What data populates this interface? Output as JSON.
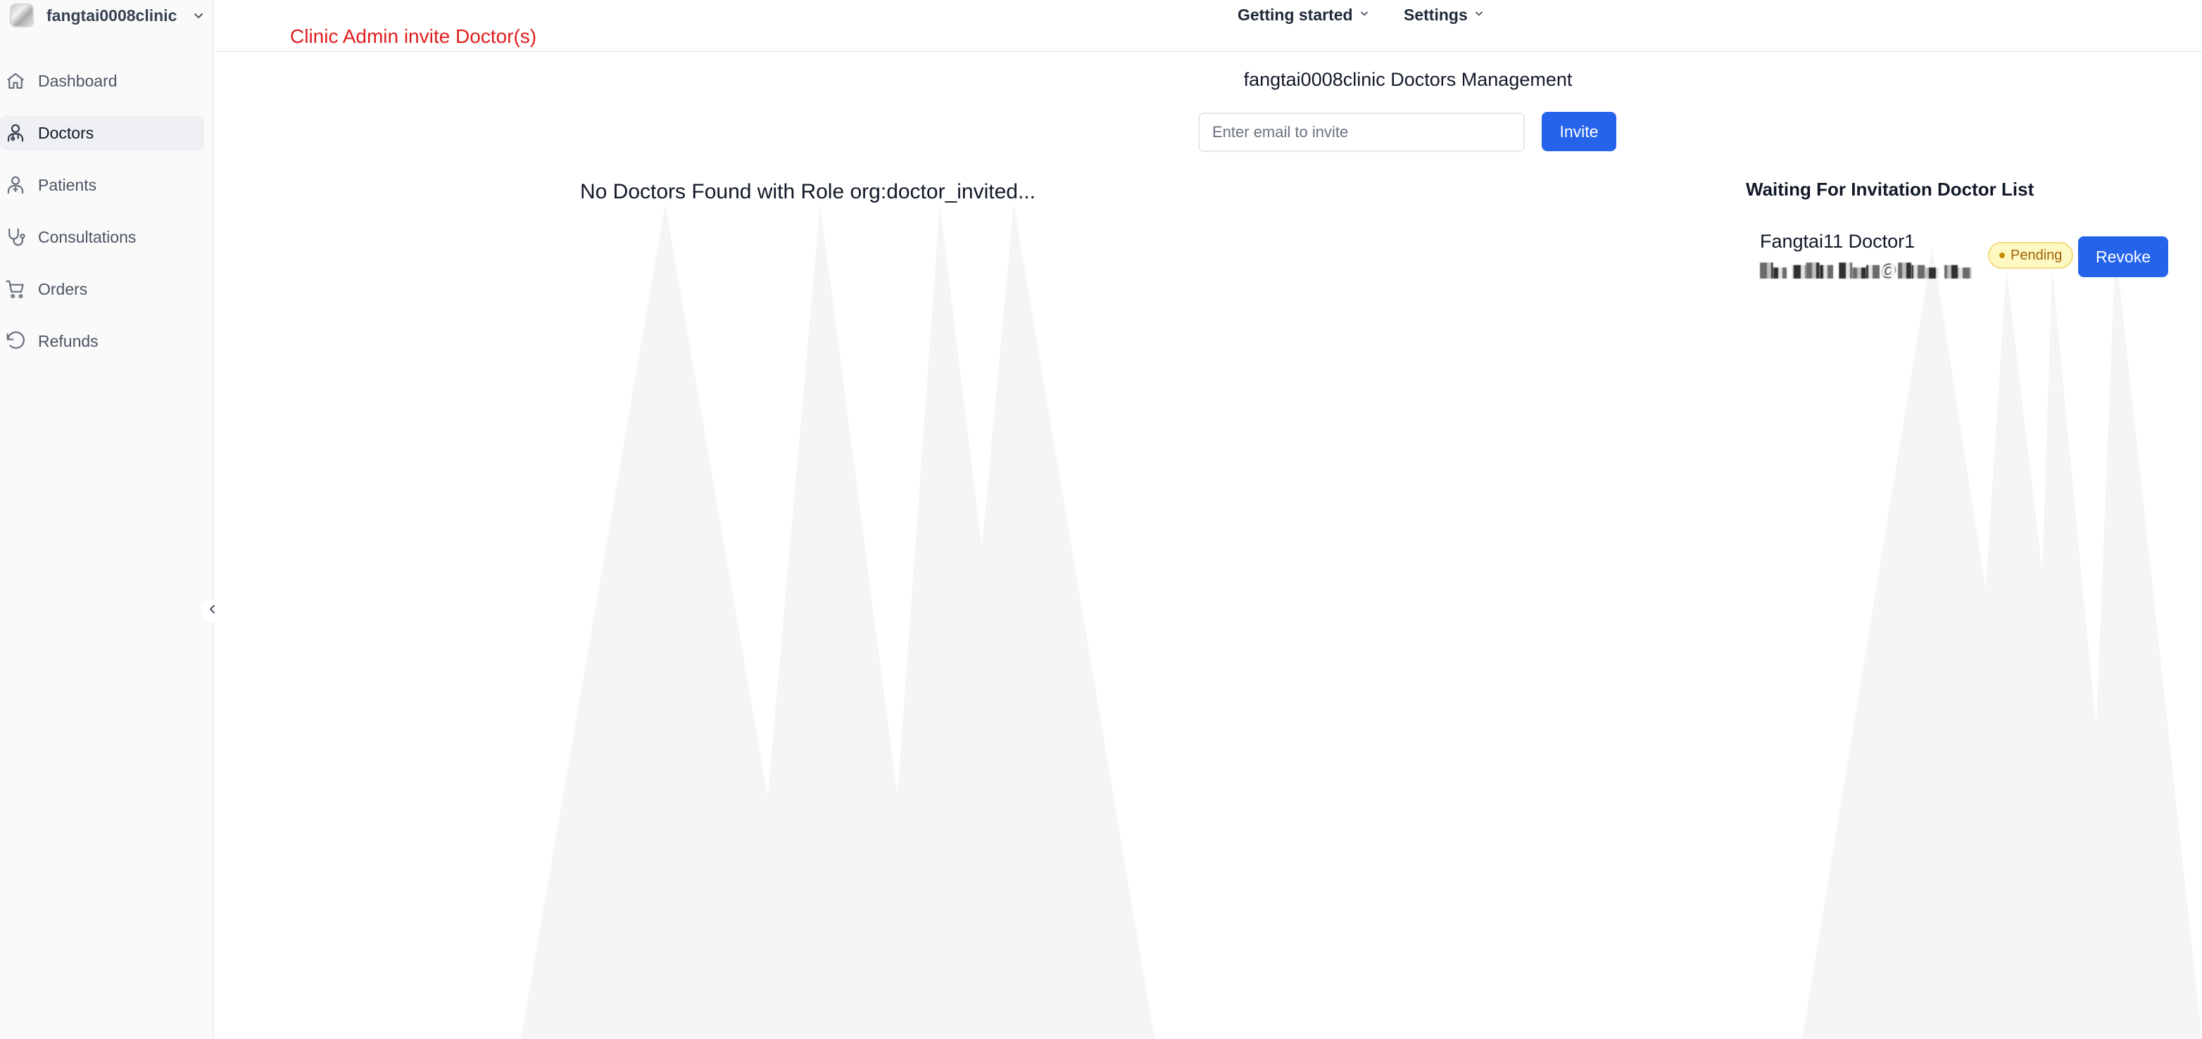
{
  "sidebar": {
    "org_name": "fangtai0008clinic",
    "items": [
      {
        "label": "Dashboard",
        "icon": "home-icon"
      },
      {
        "label": "Doctors",
        "icon": "doctor-icon",
        "active": true
      },
      {
        "label": "Patients",
        "icon": "patient-icon"
      },
      {
        "label": "Consultations",
        "icon": "stethoscope-icon"
      },
      {
        "label": "Orders",
        "icon": "cart-icon"
      },
      {
        "label": "Refunds",
        "icon": "undo-icon"
      }
    ]
  },
  "topbar": {
    "getting_started_label": "Getting started",
    "settings_label": "Settings"
  },
  "annotation": "Clinic Admin invite Doctor(s)",
  "main": {
    "title": "fangtai0008clinic Doctors Management",
    "invite_placeholder": "Enter email to invite",
    "invite_value": "",
    "invite_button": "Invite",
    "empty_message": "No Doctors Found with Role org:doctor_invited..."
  },
  "waiting": {
    "title": "Waiting For Invitation Doctor List",
    "doctors": [
      {
        "name": "Fangtai11 Doctor1",
        "email": "▇▅ ▆▇▆ ▇▅▆@▇▆▅ ▆▅",
        "status": "Pending",
        "action": "Revoke"
      }
    ]
  },
  "colors": {
    "primary": "#2563eb",
    "annotation": "#e11d1d",
    "pending_bg": "#fef9c3",
    "pending_text": "#a16207"
  }
}
